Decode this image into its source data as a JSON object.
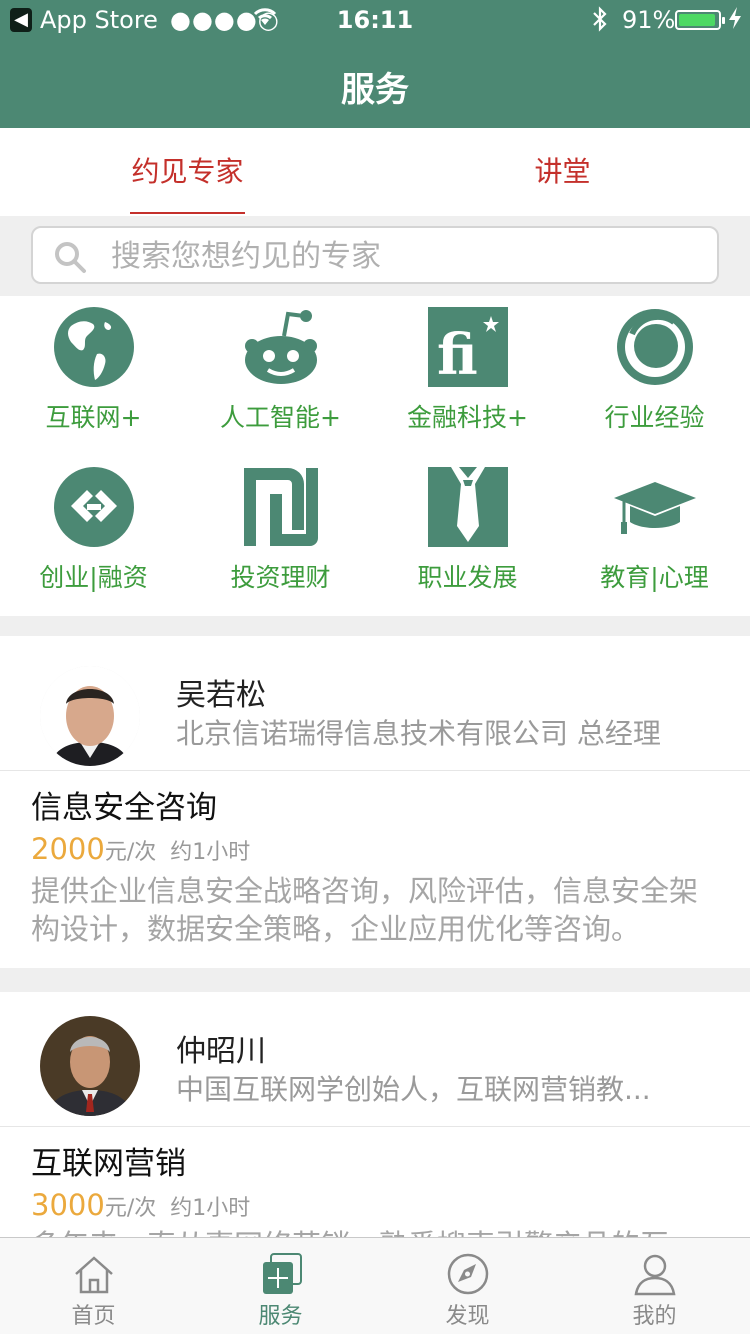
{
  "status_bar": {
    "back_glyph": "◀",
    "carrier": "App Store",
    "signal": "●●●●○",
    "time": "16:11",
    "battery_pct": "91%",
    "battery_level": 0.91
  },
  "nav": {
    "title": "服务"
  },
  "tabs": [
    {
      "label": "约见专家",
      "active": true
    },
    {
      "label": "讲堂",
      "active": false
    }
  ],
  "search": {
    "placeholder": "搜索您想约见的专家"
  },
  "categories": [
    {
      "label": "互联网+",
      "icon": "globe-icon"
    },
    {
      "label": "人工智能+",
      "icon": "robot-icon"
    },
    {
      "label": "金融科技+",
      "icon": "fi-icon"
    },
    {
      "label": "行业经验",
      "icon": "ring-icon"
    },
    {
      "label": "创业|融资",
      "icon": "link-icon"
    },
    {
      "label": "投资理财",
      "icon": "shekel-icon"
    },
    {
      "label": "职业发展",
      "icon": "tie-icon"
    },
    {
      "label": "教育|心理",
      "icon": "graduation-cap-icon"
    }
  ],
  "experts": [
    {
      "name": "吴若松",
      "org": "北京信诺瑞得信息技术有限公司 总经理",
      "service": "信息安全咨询",
      "price": "2000",
      "unit": "元/次",
      "duration": "约1小时",
      "desc": "提供企业信息安全战略咨询，风险评估，信息安全架构设计，数据安全策略，企业应用优化等咨询。"
    },
    {
      "name": "仲昭川",
      "org": "中国互联网学创始人，互联网营销教...",
      "service": "互联网营销",
      "price": "3000",
      "unit": "元/次",
      "duration": "约1小时",
      "desc": "多年来一直从事网络营销，熟悉搜索引擎产品的互"
    }
  ],
  "tabbar": [
    {
      "label": "首页",
      "icon": "home-icon",
      "active": false
    },
    {
      "label": "服务",
      "icon": "service-icon",
      "active": true
    },
    {
      "label": "发现",
      "icon": "compass-icon",
      "active": false
    },
    {
      "label": "我的",
      "icon": "user-icon",
      "active": false
    }
  ],
  "colors": {
    "primary": "#4c8873",
    "tab_red": "#c4302b",
    "category_green": "#3d9c3d",
    "price_orange": "#eba93d"
  }
}
